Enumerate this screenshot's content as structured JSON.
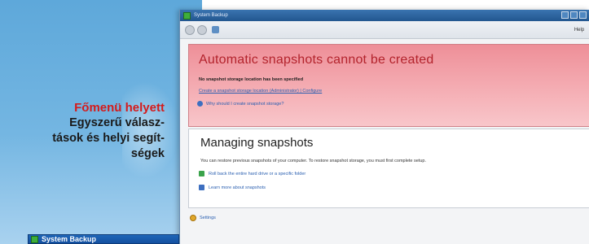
{
  "callout": {
    "title": "Főmenü helyett",
    "body_lines": [
      "Egyszerű válasz-",
      "tások és helyi segít-",
      "ségek"
    ]
  },
  "main_window": {
    "title": "System Backup",
    "help_label": "Help",
    "alert": {
      "title": "Automatic snapshots cannot be created",
      "bold_text": "No snapshot storage location has been specified",
      "link_text": "Create a snapshot storage location (Administrator) | Configure",
      "help_text": "Why should I create snapshot storage?"
    },
    "panel": {
      "title": "Managing snapshots",
      "description": "You can restore previous snapshots of your computer. To restore snapshot storage, you must first complete setup.",
      "rows": [
        {
          "text": "Roll back the entire hard drive or a specific folder",
          "icon": "restore-icon",
          "color": "#3aa34b"
        },
        {
          "text": "Learn more about snapshots",
          "icon": "info-icon",
          "color": "#3d6fc0"
        }
      ]
    },
    "settings_label": "Settings"
  },
  "secondary_window": {
    "title": "System Backup"
  },
  "colors": {
    "callout_title": "#d41b1b",
    "alert_title": "#b3232c",
    "link": "#2a5fb0",
    "alert_bg": "#f5b0b6",
    "titlebar": "#22568f"
  }
}
